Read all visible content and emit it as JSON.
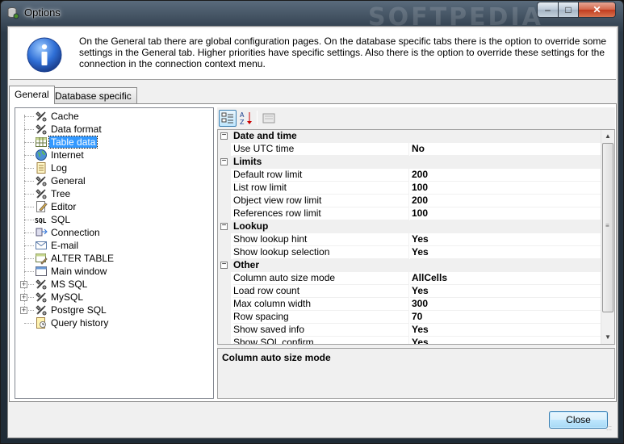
{
  "window": {
    "title": "Options",
    "watermark": "SOFTPEDIA"
  },
  "info": {
    "text": "On the General tab there are global configuration pages. On the database specific tabs there is the option to override some settings in the General tab. Higher priorities have specific settings. Also there is the option to override these settings for the connection in the connection context menu."
  },
  "tabs": [
    {
      "label": "General",
      "active": true
    },
    {
      "label": "Database specific",
      "active": false
    }
  ],
  "tree": {
    "items": [
      {
        "label": "Cache",
        "icon": "tools-icon",
        "expandable": false
      },
      {
        "label": "Data format",
        "icon": "tools-icon",
        "expandable": false
      },
      {
        "label": "Table data",
        "icon": "table-icon",
        "expandable": false,
        "selected": true
      },
      {
        "label": "Internet",
        "icon": "globe-icon",
        "expandable": false
      },
      {
        "label": "Log",
        "icon": "log-icon",
        "expandable": false
      },
      {
        "label": "General",
        "icon": "tools-icon",
        "expandable": false
      },
      {
        "label": "Tree",
        "icon": "tools-icon",
        "expandable": false
      },
      {
        "label": "Editor",
        "icon": "editor-icon",
        "expandable": false
      },
      {
        "label": "SQL",
        "icon": "sql-icon",
        "expandable": false
      },
      {
        "label": "Connection",
        "icon": "connection-icon",
        "expandable": false
      },
      {
        "label": "E-mail",
        "icon": "email-icon",
        "expandable": false
      },
      {
        "label": "ALTER TABLE",
        "icon": "alter-table-icon",
        "expandable": false
      },
      {
        "label": "Main window",
        "icon": "window-icon",
        "expandable": false
      },
      {
        "label": "MS SQL",
        "icon": "tools-icon",
        "expandable": true
      },
      {
        "label": "MySQL",
        "icon": "tools-icon",
        "expandable": true
      },
      {
        "label": "Postgre SQL",
        "icon": "tools-icon",
        "expandable": true
      },
      {
        "label": "Query history",
        "icon": "history-icon",
        "expandable": false
      }
    ]
  },
  "toolbar": {
    "categorized_icon": "categorized-icon",
    "alphabetical_icon": "sort-az-icon",
    "property_pages_icon": "property-pages-icon"
  },
  "properties": {
    "rows": [
      {
        "kind": "category",
        "name": "Date and time"
      },
      {
        "kind": "prop",
        "name": "Use UTC time",
        "value": "No"
      },
      {
        "kind": "category",
        "name": "Limits"
      },
      {
        "kind": "prop",
        "name": "Default row limit",
        "value": "200"
      },
      {
        "kind": "prop",
        "name": "List row limit",
        "value": "100"
      },
      {
        "kind": "prop",
        "name": "Object view row limit",
        "value": "200"
      },
      {
        "kind": "prop",
        "name": "References row limit",
        "value": "100"
      },
      {
        "kind": "category",
        "name": "Lookup"
      },
      {
        "kind": "prop",
        "name": "Show lookup hint",
        "value": "Yes"
      },
      {
        "kind": "prop",
        "name": "Show lookup selection",
        "value": "Yes"
      },
      {
        "kind": "category",
        "name": "Other"
      },
      {
        "kind": "prop",
        "name": "Column auto size mode",
        "value": "AllCells"
      },
      {
        "kind": "prop",
        "name": "Load row count",
        "value": "Yes"
      },
      {
        "kind": "prop",
        "name": "Max column width",
        "value": "300"
      },
      {
        "kind": "prop",
        "name": "Row spacing",
        "value": "70"
      },
      {
        "kind": "prop",
        "name": "Show saved info",
        "value": "Yes"
      },
      {
        "kind": "prop",
        "name": "Show SQL confirm",
        "value": "Yes"
      }
    ]
  },
  "description": {
    "title": "Column auto size mode"
  },
  "buttons": {
    "close": "Close"
  },
  "colors": {
    "selection": "#3399ff",
    "accent": "#3c7fb1"
  }
}
